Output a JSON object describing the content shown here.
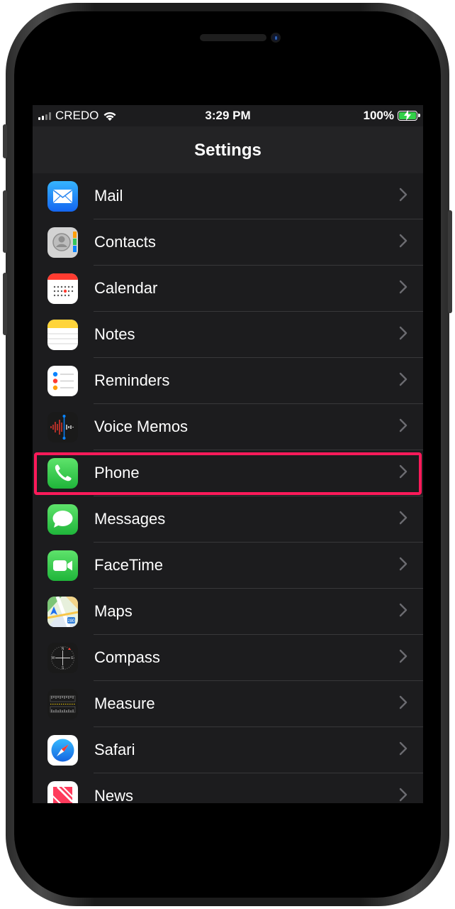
{
  "status_bar": {
    "carrier": "CREDO",
    "time": "3:29 PM",
    "battery_percent": "100%",
    "battery_level": 1.0,
    "signal_bars": 2,
    "icons": [
      "signal-icon",
      "wifi-icon",
      "battery-charging-icon"
    ]
  },
  "nav": {
    "title": "Settings"
  },
  "settings_list": [
    {
      "label": "Mail",
      "icon": "mail-icon",
      "color": "#1e8cf7"
    },
    {
      "label": "Contacts",
      "icon": "contacts-icon",
      "color": "#cfcfcf"
    },
    {
      "label": "Calendar",
      "icon": "calendar-icon",
      "color": "#ffffff"
    },
    {
      "label": "Notes",
      "icon": "notes-icon",
      "color": "#ffd43a"
    },
    {
      "label": "Reminders",
      "icon": "reminders-icon",
      "color": "#ffffff"
    },
    {
      "label": "Voice Memos",
      "icon": "voice-memos-icon",
      "color": "#1a1a1a"
    },
    {
      "label": "Phone",
      "icon": "phone-icon",
      "color": "#34c759",
      "highlighted": true
    },
    {
      "label": "Messages",
      "icon": "messages-icon",
      "color": "#34c759"
    },
    {
      "label": "FaceTime",
      "icon": "facetime-icon",
      "color": "#34c759"
    },
    {
      "label": "Maps",
      "icon": "maps-icon",
      "color": "#7cc576"
    },
    {
      "label": "Compass",
      "icon": "compass-icon",
      "color": "#1a1a1a"
    },
    {
      "label": "Measure",
      "icon": "measure-icon",
      "color": "#1a1a1a"
    },
    {
      "label": "Safari",
      "icon": "safari-icon",
      "color": "#1e8cf7"
    },
    {
      "label": "News",
      "icon": "news-icon",
      "color": "#ff3b5c"
    }
  ],
  "colors": {
    "highlight": "#ff1a5a",
    "background": "#1c1c1e"
  }
}
